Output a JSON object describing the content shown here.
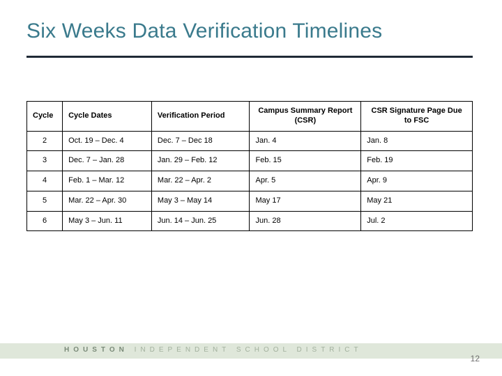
{
  "title": "Six Weeks Data Verification Timelines",
  "headers": {
    "cycle": "Cycle",
    "dates": "Cycle Dates",
    "verification": "Verification Period",
    "csr": "Campus Summary Report (CSR)",
    "sig": "CSR Signature Page Due to FSC"
  },
  "rows": [
    {
      "cycle": "2",
      "dates": "Oct. 19 – Dec. 4",
      "verification": "Dec. 7 – Dec 18",
      "csr": "Jan.  4",
      "sig": "Jan. 8"
    },
    {
      "cycle": "3",
      "dates": "Dec. 7 – Jan. 28",
      "verification": "Jan. 29 –  Feb. 12",
      "csr": "Feb. 15",
      "sig": "Feb. 19"
    },
    {
      "cycle": "4",
      "dates": "Feb. 1 – Mar. 12",
      "verification": "Mar. 22 – Apr. 2",
      "csr": "Apr. 5",
      "sig": "Apr. 9"
    },
    {
      "cycle": "5",
      "dates": "Mar. 22 – Apr. 30",
      "verification": "May 3 – May 14",
      "csr": "May 17",
      "sig": "May 21"
    },
    {
      "cycle": "6",
      "dates": "May 3 – Jun. 11",
      "verification": "Jun. 14 – Jun. 25",
      "csr": "Jun. 28",
      "sig": "Jul. 2"
    }
  ],
  "footer": {
    "brand_dark": "HOUSTON",
    "brand_light": " INDEPENDENT SCHOOL DISTRICT"
  },
  "page_number": "12",
  "chart_data": {
    "type": "table",
    "title": "Six Weeks Data Verification Timelines",
    "columns": [
      "Cycle",
      "Cycle Dates",
      "Verification Period",
      "Campus Summary Report (CSR)",
      "CSR Signature Page Due to FSC"
    ],
    "rows": [
      [
        "2",
        "Oct. 19 – Dec. 4",
        "Dec. 7 – Dec 18",
        "Jan. 4",
        "Jan. 8"
      ],
      [
        "3",
        "Dec. 7 – Jan. 28",
        "Jan. 29 – Feb. 12",
        "Feb. 15",
        "Feb. 19"
      ],
      [
        "4",
        "Feb. 1 – Mar. 12",
        "Mar. 22 – Apr. 2",
        "Apr. 5",
        "Apr. 9"
      ],
      [
        "5",
        "Mar. 22 – Apr. 30",
        "May 3 – May 14",
        "May 17",
        "May 21"
      ],
      [
        "6",
        "May 3 – Jun. 11",
        "Jun. 14 – Jun. 25",
        "Jun. 28",
        "Jul. 2"
      ]
    ]
  }
}
